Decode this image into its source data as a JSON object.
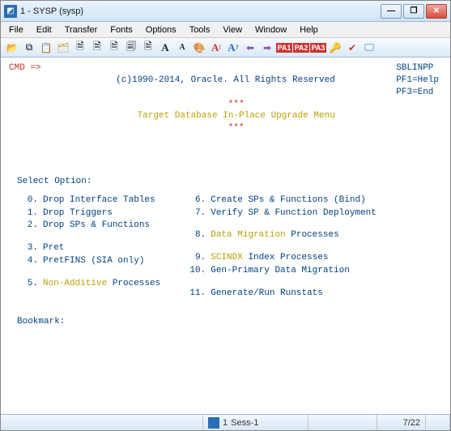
{
  "window": {
    "title": "1 - SYSP (sysp)"
  },
  "menu": {
    "file": "File",
    "edit": "Edit",
    "transfer": "Transfer",
    "fonts": "Fonts",
    "options": "Options",
    "tools": "Tools",
    "view": "View",
    "window": "Window",
    "help": "Help"
  },
  "terminal": {
    "cmd_label": "CMD =>",
    "copyright": "(c)1990-2014, Oracle. All Rights Reserved",
    "stars": "***",
    "menu_title": "Target Database In-Place Upgrade Menu",
    "top_right_id": "SBLINPP",
    "pf1": "PF1=Help",
    "pf3": "PF3=End",
    "select_label": "Select Option:",
    "bookmark_label": "Bookmark:",
    "left_options": [
      {
        "num": "0.",
        "label": "Drop Interface Tables",
        "cls": ""
      },
      {
        "num": "1.",
        "label": "Drop Triggers",
        "cls": ""
      },
      {
        "num": "2.",
        "label": "Drop SPs & Functions",
        "cls": ""
      },
      {
        "num": "",
        "label": "",
        "cls": ""
      },
      {
        "num": "3.",
        "label": "Pret",
        "cls": ""
      },
      {
        "num": "4.",
        "label": "PretFINS (SIA only)",
        "cls": ""
      },
      {
        "num": "",
        "label": "",
        "cls": ""
      },
      {
        "num": "5.",
        "label": "Non-Additive",
        "cls": "yellow",
        "suffix": " Processes"
      }
    ],
    "right_options": [
      {
        "num": "6.",
        "label": "Create SPs & Functions (Bind)",
        "cls": ""
      },
      {
        "num": "7.",
        "label": "Verify SP & Function Deployment",
        "cls": ""
      },
      {
        "num": "",
        "label": "",
        "cls": ""
      },
      {
        "num": "8.",
        "label": "Data Migration",
        "cls": "yellow",
        "suffix": " Processes"
      },
      {
        "num": "",
        "label": "",
        "cls": ""
      },
      {
        "num": "9.",
        "label": "SCINDX",
        "cls": "yellow",
        "suffix": " Index Processes"
      },
      {
        "num": "10.",
        "label": "Gen-Primary Data Migration",
        "cls": ""
      },
      {
        "num": "",
        "label": "",
        "cls": ""
      },
      {
        "num": "11.",
        "label": "Generate/Run Runstats",
        "cls": ""
      }
    ]
  },
  "status": {
    "session_num": "1",
    "session_name": "Sess-1",
    "cursor_pos": "7/22"
  }
}
